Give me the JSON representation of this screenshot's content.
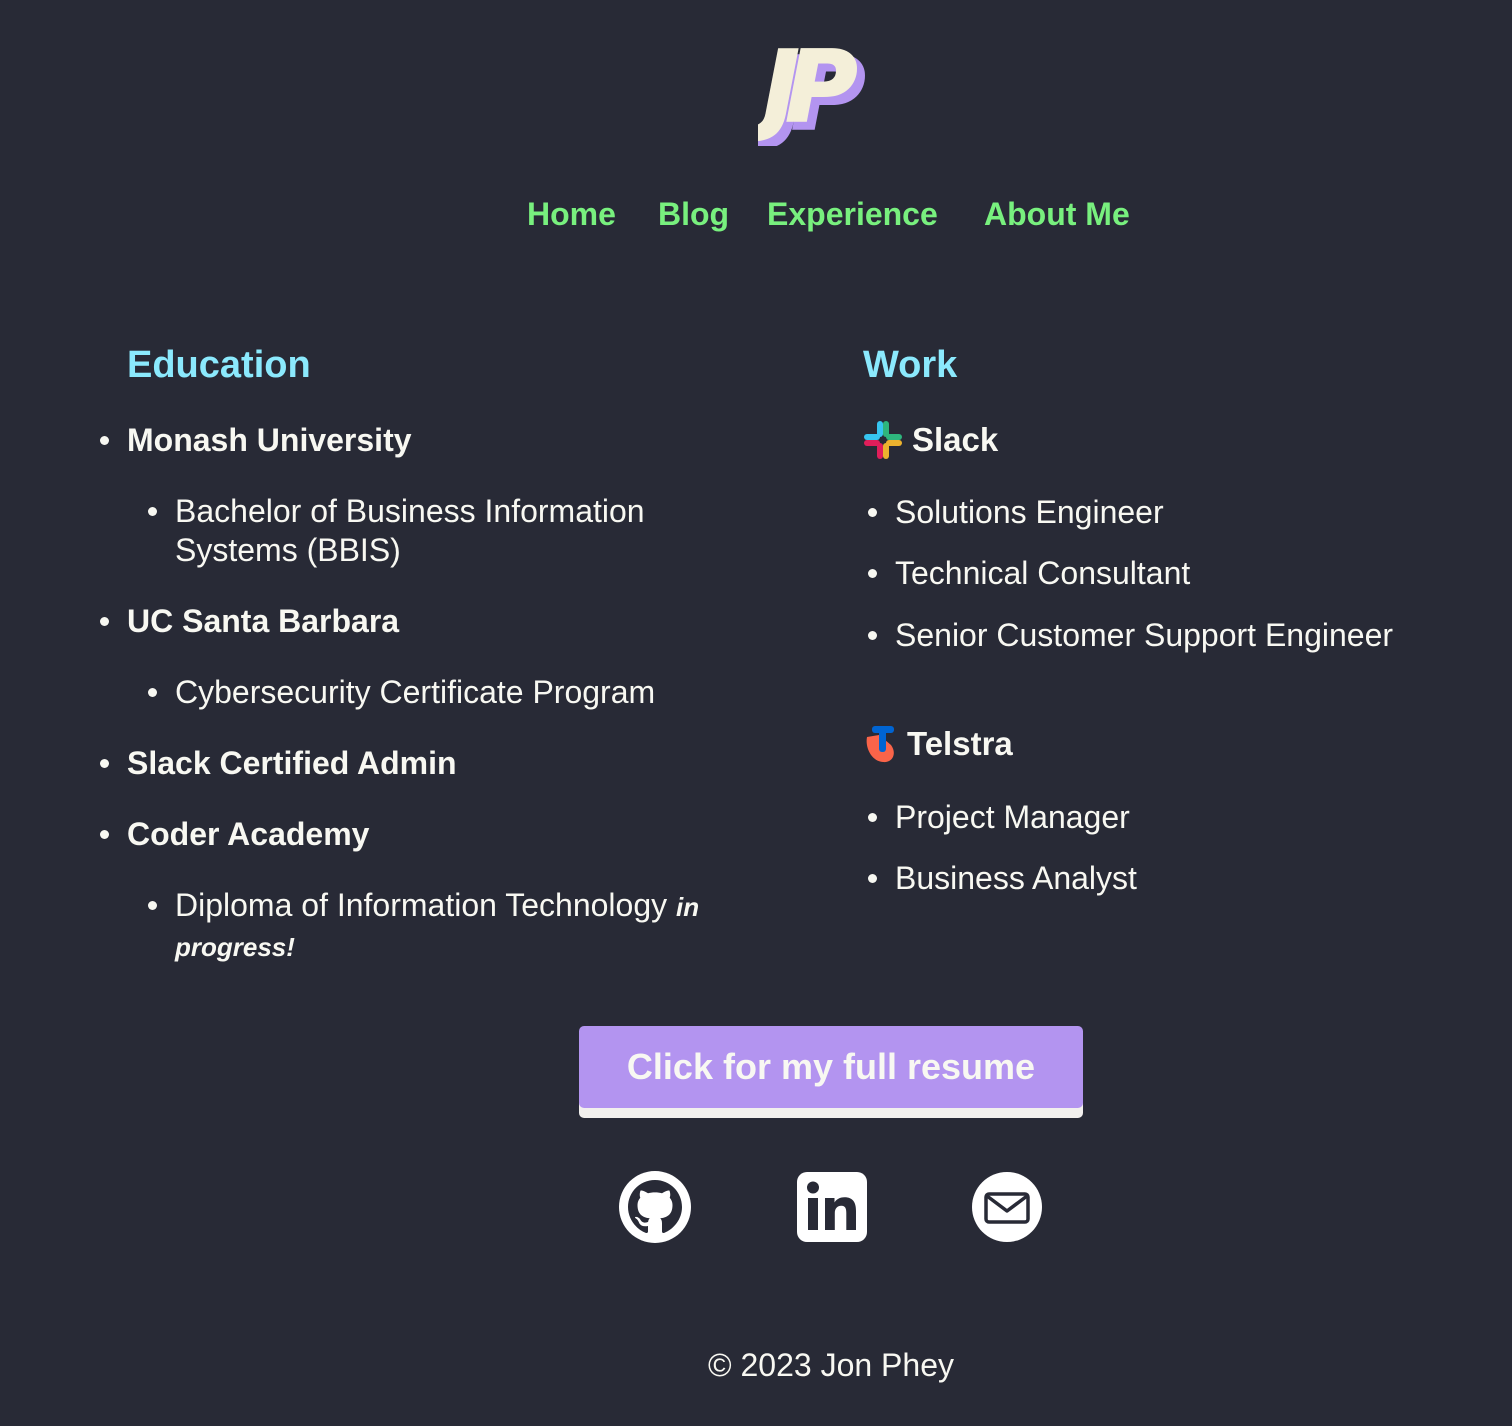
{
  "logo": {
    "text": "JP"
  },
  "nav": {
    "items": [
      {
        "label": "Home"
      },
      {
        "label": "Blog"
      },
      {
        "label": "Experience"
      },
      {
        "label": "About Me"
      }
    ]
  },
  "education": {
    "title": "Education",
    "schools": [
      {
        "name": "Monash University",
        "details": [
          "Bachelor of Business Information",
          "Systems (BBIS)"
        ]
      },
      {
        "name": "UC Santa Barbara",
        "details": [
          "Cybersecurity Certificate Program"
        ]
      },
      {
        "name": "Slack Certified Admin",
        "details": []
      },
      {
        "name": "Coder Academy",
        "details": [
          "Diploma of Information Technology"
        ],
        "note_a": "in",
        "note_b": "progress!"
      }
    ]
  },
  "work": {
    "title": "Work",
    "companies": [
      {
        "name": "Slack",
        "icon": "slack-icon",
        "roles": [
          "Solutions Engineer",
          "Technical Consultant",
          "Senior Customer Support Engineer"
        ]
      },
      {
        "name": "Telstra",
        "icon": "telstra-icon",
        "roles": [
          "Project Manager",
          "Business Analyst"
        ]
      }
    ]
  },
  "resume_button": {
    "label": "Click for my full resume"
  },
  "social": [
    "github-icon",
    "linkedin-icon",
    "email-icon"
  ],
  "footer": {
    "text": "© 2023 Jon Phey"
  },
  "colors": {
    "background": "#282a36",
    "nav": "#78f07e",
    "heading": "#8be9fd",
    "button": "#b394f0",
    "text": "#f8f8f2"
  }
}
